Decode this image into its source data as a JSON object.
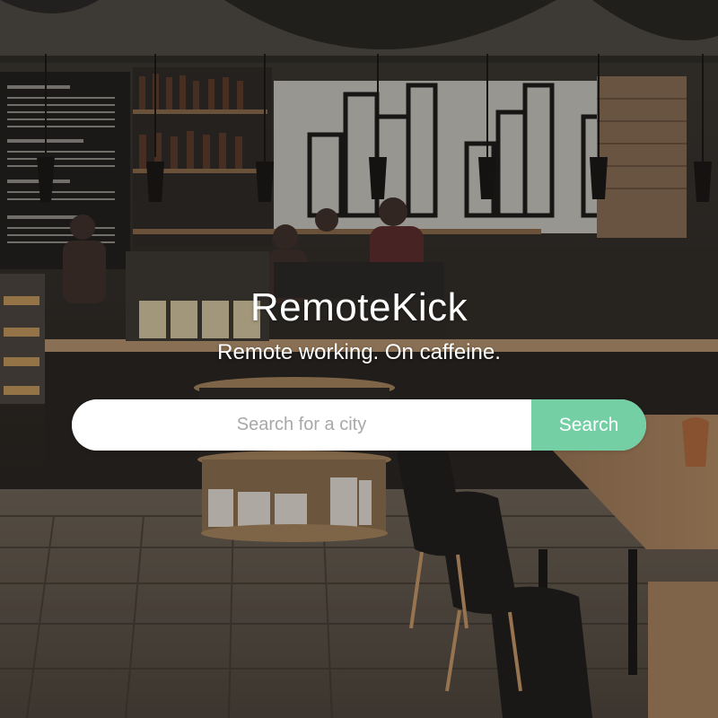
{
  "brand": {
    "title": "RemoteKick",
    "tagline": "Remote working. On caffeine."
  },
  "search": {
    "placeholder": "Search for a city",
    "value": "",
    "button_label": "Search"
  },
  "colors": {
    "accent": "#74cfa5",
    "text": "#ffffff"
  }
}
